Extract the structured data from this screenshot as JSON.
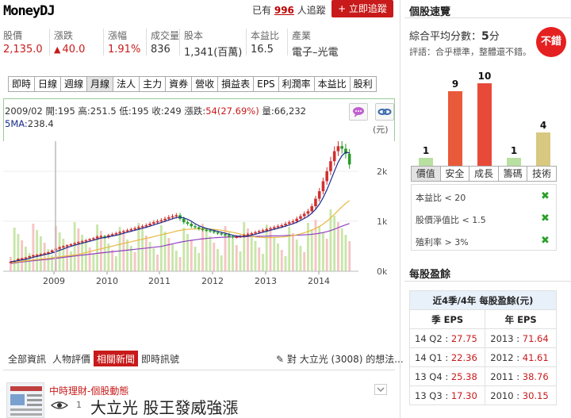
{
  "header": {
    "logo_text": "MoneyDJ",
    "follow_prefix": "已有",
    "follow_count": "996",
    "follow_suffix": "人追蹤",
    "follow_button": "+ 立即追蹤"
  },
  "stats": [
    {
      "label": "股價",
      "value": "2,135.0",
      "color": "#c81a1a"
    },
    {
      "label": "漲跌",
      "value": "40.0",
      "color": "#c81a1a"
    },
    {
      "label": "漲幅",
      "value": "1.91%",
      "color": "#c81a1a"
    },
    {
      "label": "成交量",
      "value": "836",
      "color": "#333333"
    },
    {
      "label": "股本",
      "value": "1,341(百萬)",
      "color": "#333333"
    },
    {
      "label": "本益比",
      "value": "16.5",
      "color": "#333333"
    },
    {
      "label": "產業",
      "value": "電子–光電",
      "color": "#333333"
    }
  ],
  "tabs": [
    "即時",
    "日線",
    "週線",
    "月線",
    "法人",
    "主力",
    "資券",
    "營收",
    "損益表",
    "EPS",
    "利潤率",
    "本益比",
    "股利"
  ],
  "active_tab": "月線",
  "chart_info": {
    "date": "2009/02",
    "open_label": "開:",
    "open": "195",
    "high_label": "高:",
    "high": "251.5",
    "low_label": "低:",
    "low": "195",
    "close_label": "收:",
    "close": "249",
    "change_label": "漲跌:",
    "change": "54(27.69%)",
    "volume_label": "量:",
    "volume": "66,232",
    "ma_label": "5MA:",
    "ma": "238.4",
    "unit": "(元)"
  },
  "chart_data": {
    "type": "candlestick",
    "x_ticks": [
      "2009",
      "2010",
      "2011",
      "2012",
      "2013",
      "2014"
    ],
    "y_ticks": [
      "2k",
      "1k",
      "0k"
    ],
    "ylim": [
      0,
      2600
    ],
    "price_close_series": [
      190,
      210,
      249,
      260,
      275,
      300,
      320,
      330,
      345,
      360,
      380,
      420,
      450,
      480,
      500,
      520,
      540,
      560,
      580,
      600,
      620,
      640,
      660,
      690,
      700,
      680,
      720,
      740,
      760,
      780,
      800,
      820,
      840,
      860,
      880,
      900,
      920,
      950,
      980,
      1000,
      1020,
      1050,
      1080,
      1100,
      1120,
      1050,
      980,
      950,
      900,
      880,
      850,
      830,
      820,
      800,
      780,
      760,
      740,
      720,
      700,
      680,
      690,
      700,
      720,
      740,
      760,
      780,
      800,
      820,
      840,
      860,
      880,
      900,
      920,
      950,
      980,
      1000,
      1050,
      1100,
      1150,
      1200,
      1300,
      1450,
      1600,
      1800,
      2000,
      2200,
      2400,
      2500,
      2450,
      2350,
      2135
    ],
    "ma_series": [
      {
        "name": "5MA",
        "color": "#1a2a8a"
      },
      {
        "name": "MA-20",
        "color": "#e8b840"
      },
      {
        "name": "MA-60",
        "color": "#9040c0"
      }
    ],
    "volume_label_color": "#c8e6a8"
  },
  "news": {
    "tabs": [
      "全部資訊",
      "人物評價",
      "相關新聞",
      "即時訊號"
    ],
    "active": "相關新聞",
    "search_text": "對 大立光 (3008) 的想法...",
    "source": "中時理財-個股動態",
    "count": "1",
    "title": "大立光 股王發威強漲"
  },
  "right": {
    "title": "個股速覽",
    "score_label": "綜合平均分數：",
    "score": "5",
    "score_unit": "分",
    "comment": "評語：合乎標準，整體還不錯。",
    "badge": "不錯",
    "bars": [
      {
        "name": "價值",
        "value": 1,
        "color": "#b8e0a0"
      },
      {
        "name": "安全",
        "value": 9,
        "color": "#e85a3a"
      },
      {
        "name": "成長",
        "value": 10,
        "color": "#e84a3a"
      },
      {
        "name": "籌碼",
        "value": 1,
        "color": "#b8e0a0"
      },
      {
        "name": "技術",
        "value": 4,
        "color": "#d8c880"
      }
    ],
    "active_bar": "價值",
    "criteria": [
      {
        "text": "本益比 < 20",
        "check": "✖"
      },
      {
        "text": "股價淨值比 < 1.5",
        "check": "✖"
      },
      {
        "text": "殖利率 > 3%",
        "check": "✖"
      }
    ]
  },
  "eps": {
    "title": "每股盈餘",
    "caption": "近4季/4年 每股盈餘(元)",
    "col1": "季 EPS",
    "col2": "年 EPS",
    "rows": [
      {
        "q": "14 Q2",
        "qv": "27.75",
        "y": "2013",
        "yv": "71.64"
      },
      {
        "q": "14 Q1",
        "qv": "22.36",
        "y": "2012",
        "yv": "41.61"
      },
      {
        "q": "13 Q4",
        "qv": "25.38",
        "y": "2011",
        "yv": "38.76"
      },
      {
        "q": "13 Q3",
        "qv": "17.30",
        "y": "2010",
        "yv": "30.15"
      }
    ]
  }
}
